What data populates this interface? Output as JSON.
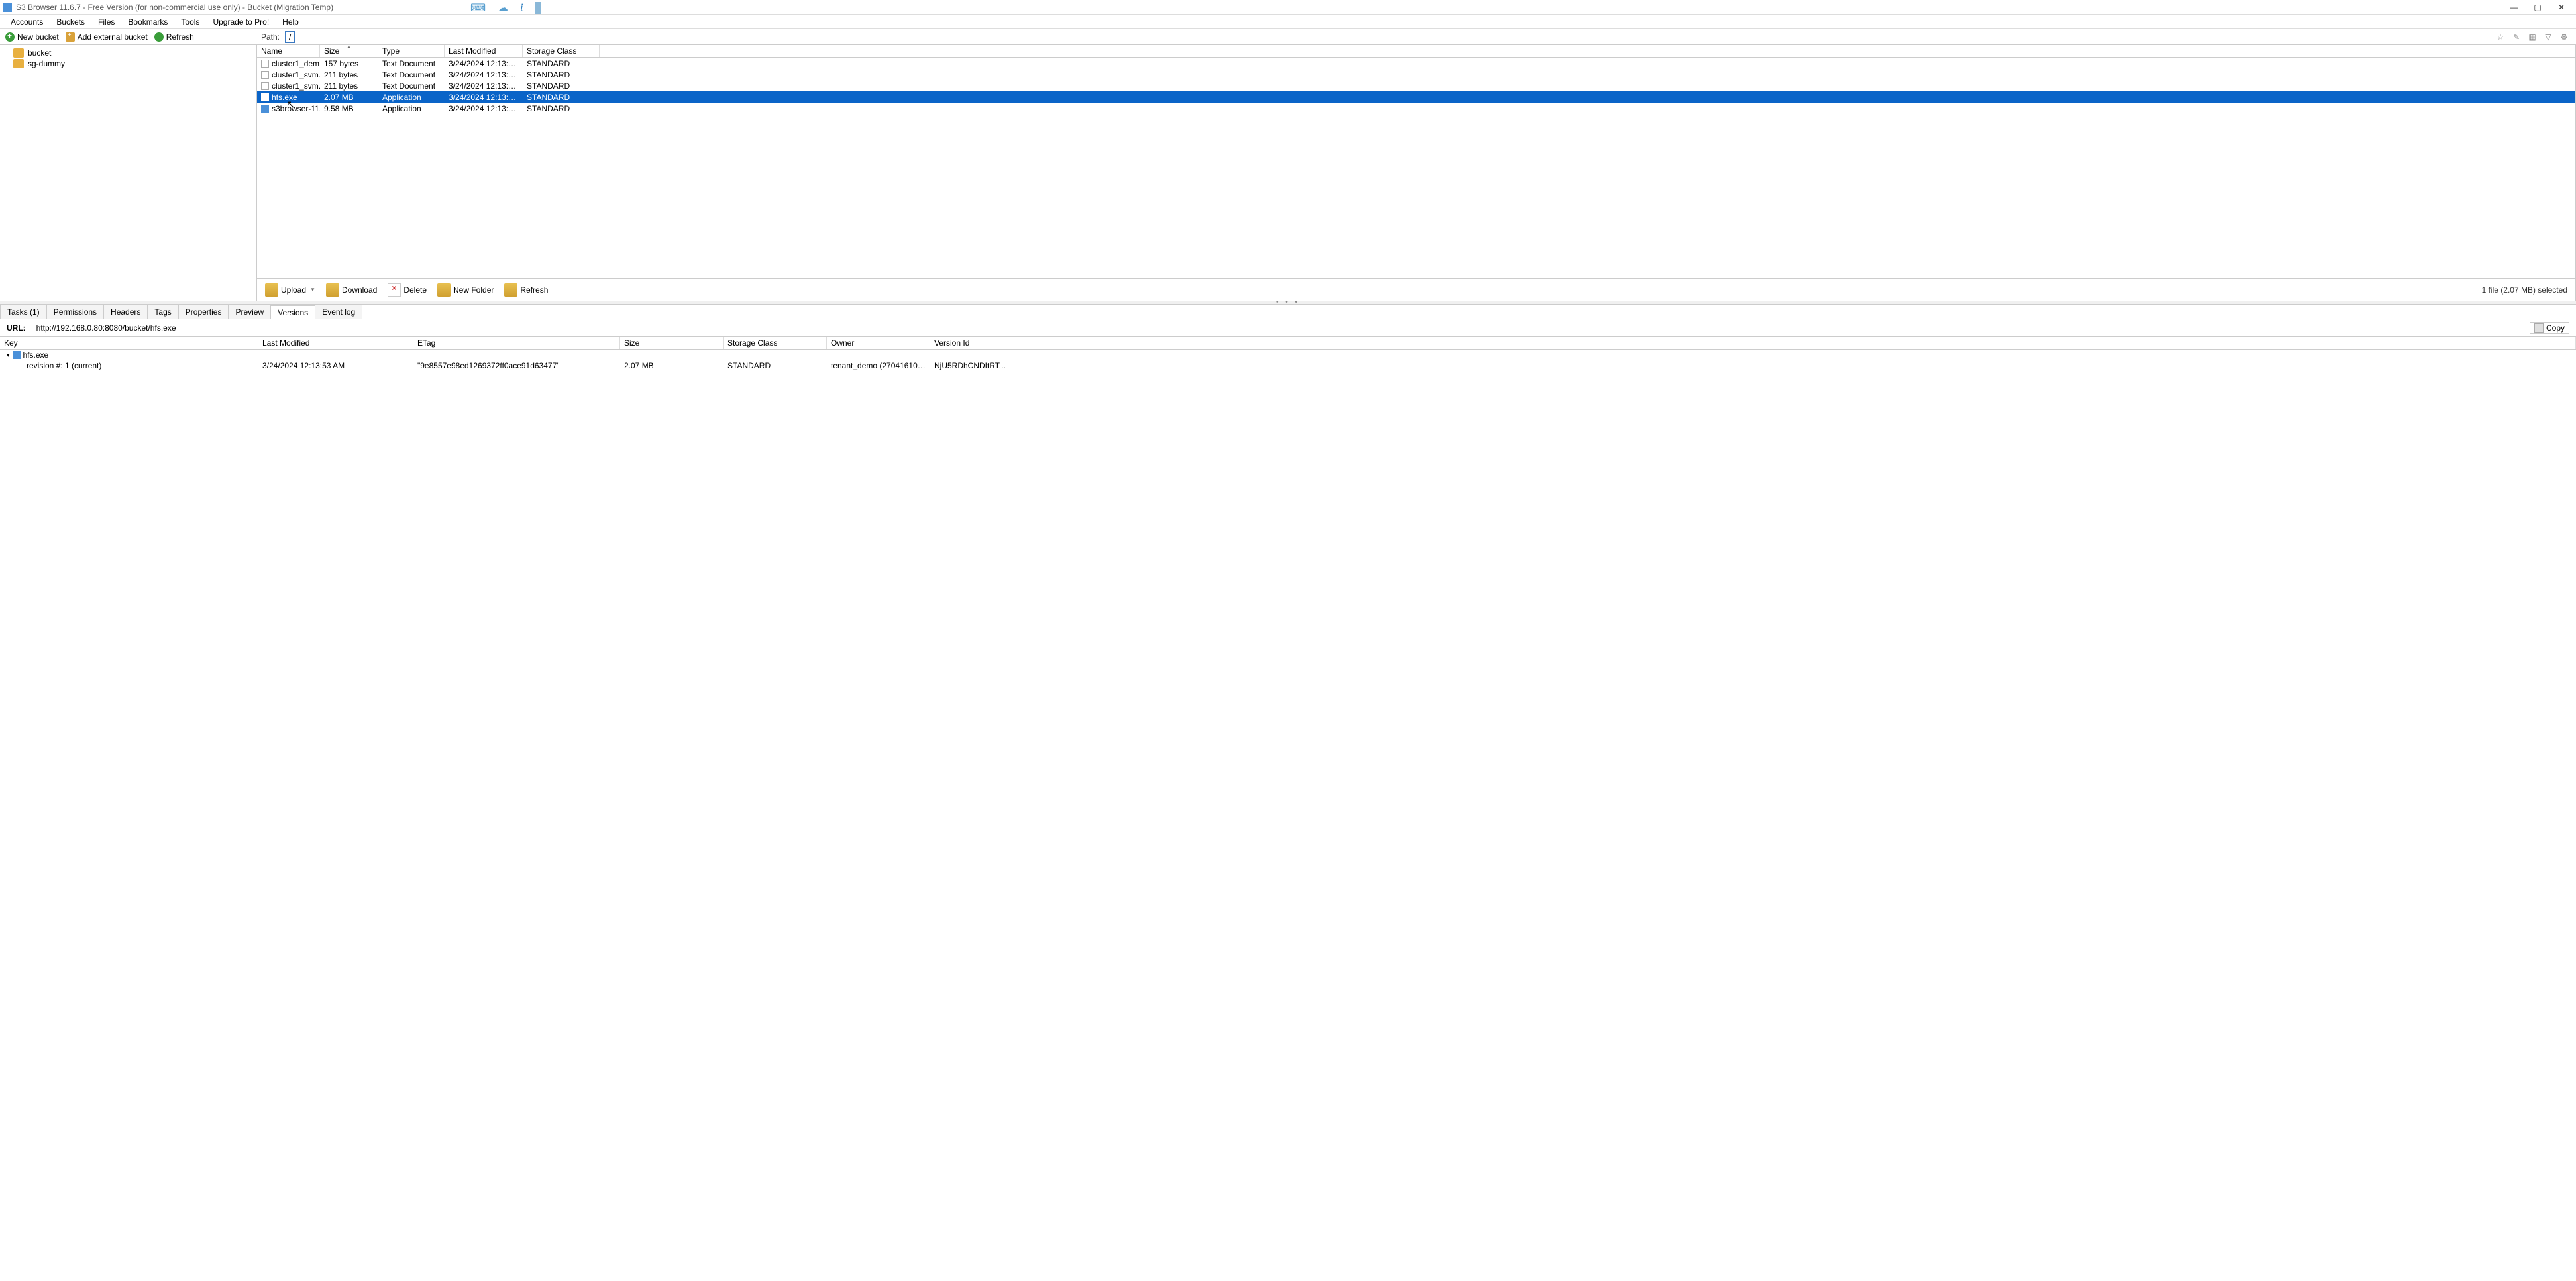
{
  "title": "S3 Browser 11.6.7 - Free Version (for non-commercial use only) - Bucket (Migration Temp)",
  "menu": [
    "Accounts",
    "Buckets",
    "Files",
    "Bookmarks",
    "Tools",
    "Upgrade to Pro!",
    "Help"
  ],
  "toolbar": {
    "new_bucket": "New bucket",
    "add_external": "Add external bucket",
    "refresh": "Refresh",
    "path_label": "Path:",
    "path_value": "/"
  },
  "buckets": [
    "bucket",
    "sg-dummy"
  ],
  "file_cols": {
    "name": "Name",
    "size": "Size",
    "type": "Type",
    "mod": "Last Modified",
    "class": "Storage Class"
  },
  "files": [
    {
      "name": "cluster1_dem...",
      "size": "157 bytes",
      "type": "Text Document",
      "mod": "3/24/2024 12:13:53 AM",
      "class": "STANDARD",
      "icon": "doc",
      "selected": false
    },
    {
      "name": "cluster1_svm...",
      "size": "211 bytes",
      "type": "Text Document",
      "mod": "3/24/2024 12:13:53 AM",
      "class": "STANDARD",
      "icon": "doc",
      "selected": false
    },
    {
      "name": "cluster1_svm...",
      "size": "211 bytes",
      "type": "Text Document",
      "mod": "3/24/2024 12:13:53 AM",
      "class": "STANDARD",
      "icon": "doc",
      "selected": false
    },
    {
      "name": "hfs.exe",
      "size": "2.07 MB",
      "type": "Application",
      "mod": "3/24/2024 12:13:53 AM",
      "class": "STANDARD",
      "icon": "exe",
      "selected": true
    },
    {
      "name": "s3browser-11...",
      "size": "9.58 MB",
      "type": "Application",
      "mod": "3/24/2024 12:13:53 AM",
      "class": "STANDARD",
      "icon": "exe",
      "selected": false
    }
  ],
  "actions": {
    "upload": "Upload",
    "download": "Download",
    "delete": "Delete",
    "newfolder": "New Folder",
    "refresh": "Refresh"
  },
  "status": "1 file (2.07 MB) selected",
  "tabs": [
    "Tasks (1)",
    "Permissions",
    "Headers",
    "Tags",
    "Properties",
    "Preview",
    "Versions",
    "Event log"
  ],
  "active_tab": 6,
  "url_label": "URL:",
  "url_value": "http://192.168.0.80:8080/bucket/hfs.exe",
  "copy_label": "Copy",
  "ver_cols": {
    "key": "Key",
    "mod": "Last Modified",
    "etag": "ETag",
    "size": "Size",
    "class": "Storage Class",
    "owner": "Owner",
    "ver": "Version Id"
  },
  "ver_key": "hfs.exe",
  "ver_rev": "revision #: 1 (current)",
  "ver_row": {
    "mod": "3/24/2024 12:13:53 AM",
    "etag": "\"9e8557e98ed1269372ff0ace91d63477\"",
    "size": "2.07 MB",
    "class": "STANDARD",
    "owner": "tenant_demo (27041610751...",
    "ver": "NjU5RDhCNDItRT..."
  }
}
